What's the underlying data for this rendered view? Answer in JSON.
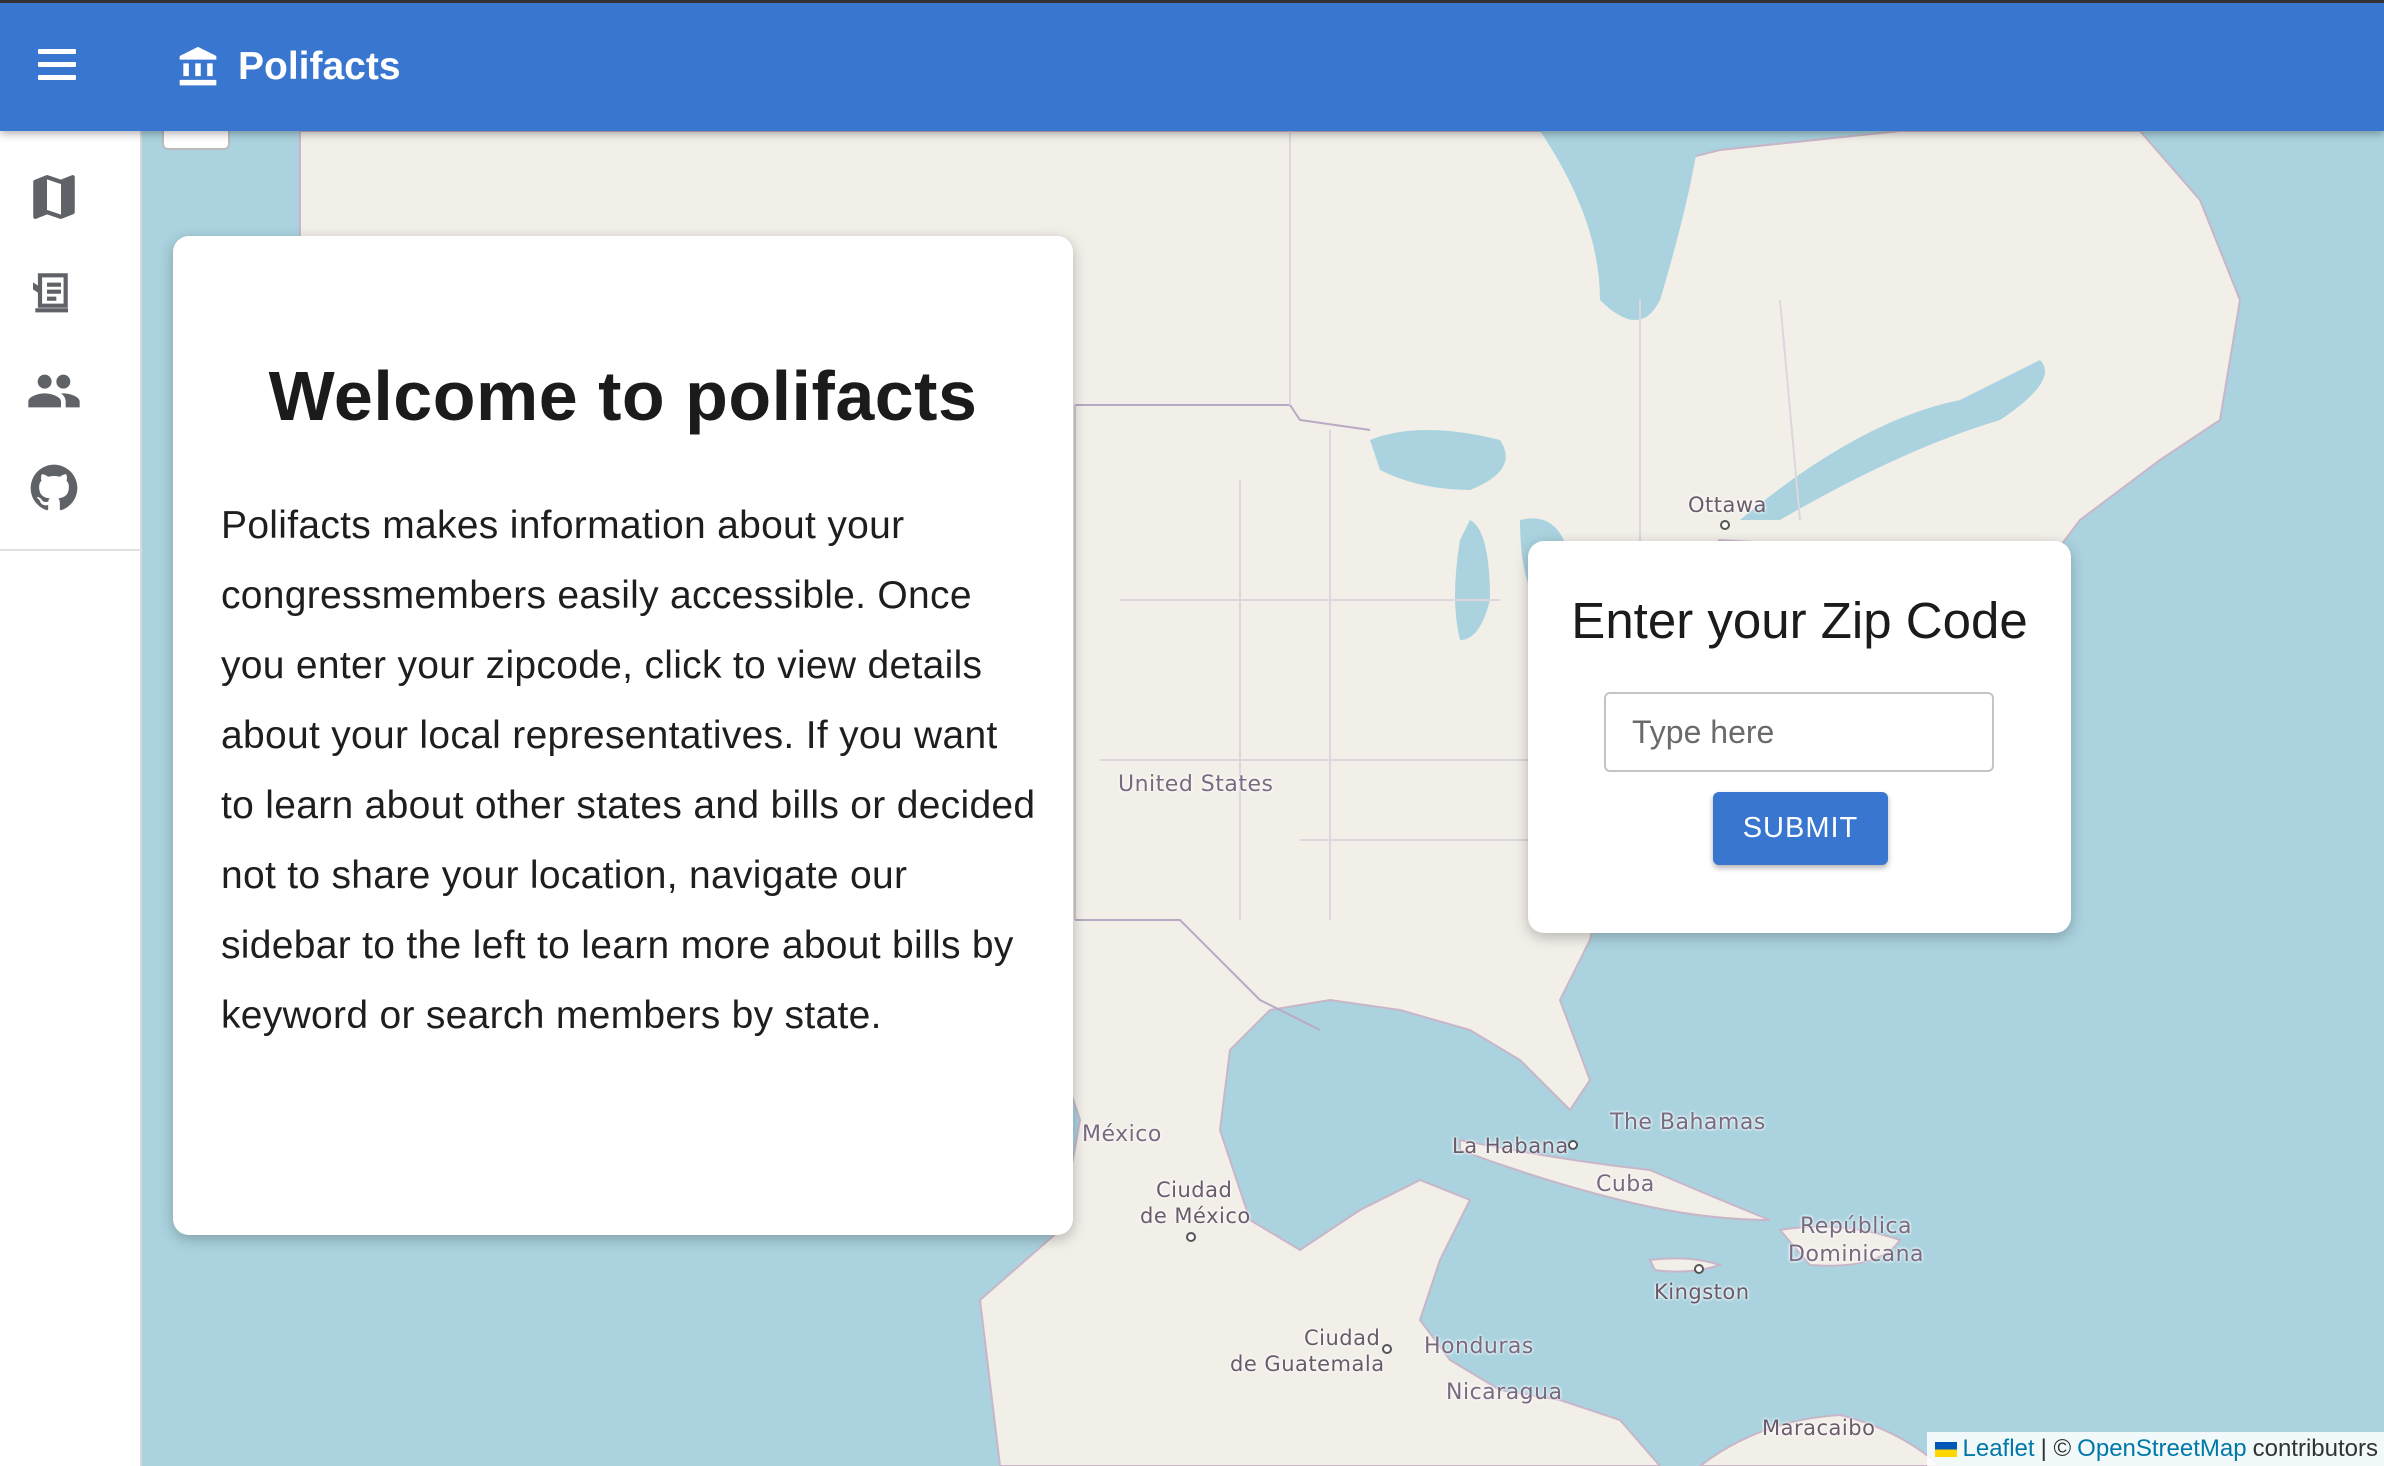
{
  "app": {
    "title": "Polifacts",
    "menu_icon": "menu-icon",
    "logo_icon": "bank-icon",
    "brand_color": "#3876cf"
  },
  "sidebar": {
    "items": [
      {
        "icon": "map-icon"
      },
      {
        "icon": "bill-icon"
      },
      {
        "icon": "people-icon"
      },
      {
        "icon": "github-icon"
      }
    ]
  },
  "welcome": {
    "title": "Welcome to polifacts",
    "body": "Polifacts makes information about your congressmembers easily accessible. Once you enter your zipcode, click to view details about your local representatives. If you want to learn about other states and bills or decided not to share your location, navigate our sidebar to the left to learn more about bills by keyword or search members by state."
  },
  "zip": {
    "title": "Enter your Zip Code",
    "placeholder": "Type here",
    "value": "",
    "submit_label": "SUBMIT"
  },
  "map": {
    "labels": {
      "ottawa": "Ottawa",
      "united_states": "United States",
      "mexico": "México",
      "ciudad_mexico_1": "Ciudad",
      "ciudad_mexico_2": "de México",
      "la_habana": "La Habana",
      "cuba": "Cuba",
      "bahamas": "The Bahamas",
      "rep_dom_1": "República",
      "rep_dom_2": "Dominicana",
      "kingston": "Kingston",
      "guatemala_1": "Ciudad",
      "guatemala_2": "de Guatemala",
      "honduras": "Honduras",
      "nicaragua": "Nicaragua",
      "maracaibo": "Maracaibo"
    }
  },
  "attribution": {
    "leaflet": "Leaflet",
    "separator": "| ©",
    "osm": "OpenStreetMap",
    "contributors": "contributors"
  }
}
